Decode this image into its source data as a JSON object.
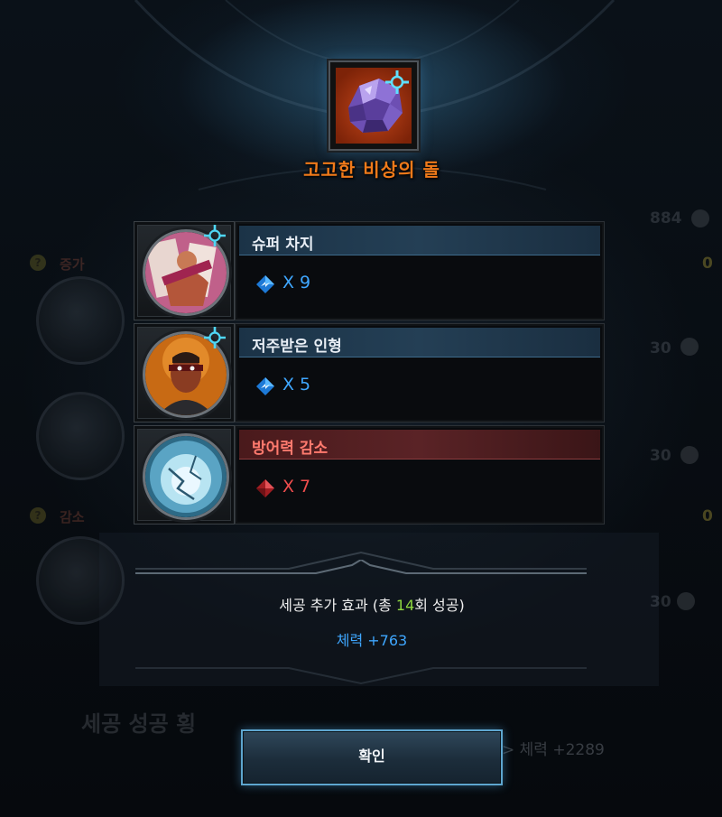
{
  "item": {
    "name": "고고한 비상의 돌",
    "icon": "purple-crystal-stone-icon"
  },
  "gems": [
    {
      "name": "슈퍼 차지",
      "count_label": "X 9",
      "bar": "blue",
      "icon": "charge-gem-icon",
      "has_rune": true
    },
    {
      "name": "저주받은 인형",
      "count_label": "X 5",
      "bar": "blue",
      "icon": "cursed-doll-gem-icon",
      "has_rune": true
    },
    {
      "name": "방어력 감소",
      "count_label": "X 7",
      "bar": "red",
      "icon": "defense-down-gem-icon",
      "has_rune": false
    }
  ],
  "bonus": {
    "title_prefix": "세공 추가 효과 (총 ",
    "success_count": "14",
    "title_suffix": "회 성공)",
    "stat": "체력 +763"
  },
  "confirm_label": "확인",
  "background": {
    "ghost_value_1": "884",
    "ghost_label_1": "증가",
    "ghost_zero_1": "0",
    "ghost_label_2": "감소",
    "ghost_zero_2": "0",
    "ghost_footer_left": "세공 성공 횡",
    "ghost_footer_right": "> 체력 +2289"
  },
  "colors": {
    "title_orange": "#f07a1a",
    "blue_accent": "#3fa7ff",
    "red_accent": "#ef4d4d",
    "highlight_green": "#8fd840"
  }
}
